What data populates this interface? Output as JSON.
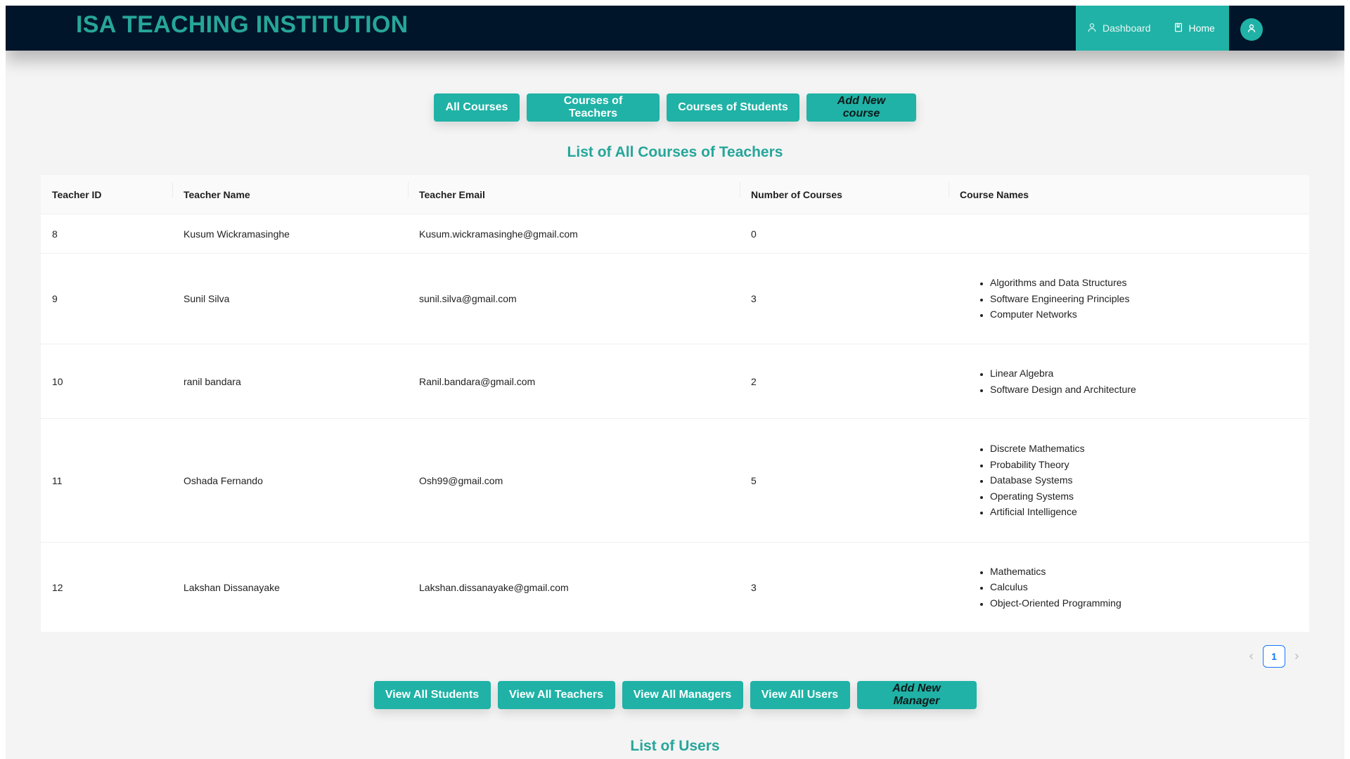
{
  "header": {
    "brand": "ISA TEACHING INSTITUTION",
    "nav": [
      {
        "label": "Dashboard",
        "icon": "user-icon"
      },
      {
        "label": "Home",
        "icon": "book-icon"
      }
    ],
    "avatar_icon": "user-icon"
  },
  "course_buttons": {
    "all_courses": "All Courses",
    "courses_of_teachers": "Courses of Teachers",
    "courses_of_students": "Courses of Students",
    "add_new_course": "Add New course"
  },
  "courses_title": "List of All Courses of Teachers",
  "table": {
    "columns": [
      "Teacher ID",
      "Teacher Name",
      "Teacher Email",
      "Number of Courses",
      "Course Names"
    ],
    "rows": [
      {
        "id": "8",
        "name": "Kusum Wickramasinghe",
        "email": "Kusum.wickramasinghe@gmail.com",
        "count": "0",
        "courses": []
      },
      {
        "id": "9",
        "name": "Sunil Silva",
        "email": "sunil.silva@gmail.com",
        "count": "3",
        "courses": [
          "Algorithms and Data Structures",
          "Software Engineering Principles",
          "Computer Networks"
        ]
      },
      {
        "id": "10",
        "name": "ranil bandara",
        "email": "Ranil.bandara@gmail.com",
        "count": "2",
        "courses": [
          "Linear Algebra",
          "Software Design and Architecture"
        ]
      },
      {
        "id": "11",
        "name": "Oshada Fernando",
        "email": "Osh99@gmail.com",
        "count": "5",
        "courses": [
          "Discrete Mathematics",
          "Probability Theory",
          "Database Systems",
          "Operating Systems",
          "Artificial Intelligence"
        ]
      },
      {
        "id": "12",
        "name": "Lakshan Dissanayake",
        "email": "Lakshan.dissanayake@gmail.com",
        "count": "3",
        "courses": [
          "Mathematics",
          "Calculus",
          "Object-Oriented Programming"
        ]
      }
    ]
  },
  "pagination": {
    "current": "1",
    "prev_icon": "chevron-left-icon",
    "next_icon": "chevron-right-icon"
  },
  "user_buttons": {
    "view_students": "View All Students",
    "view_teachers": "View All Teachers",
    "view_managers": "View All Managers",
    "view_users": "View All Users",
    "add_manager": "Add New Manager"
  },
  "users_title": "List of Users",
  "colors": {
    "header_bg": "#001529",
    "accent": "#20b2a6",
    "brand_text": "#26a69a"
  }
}
